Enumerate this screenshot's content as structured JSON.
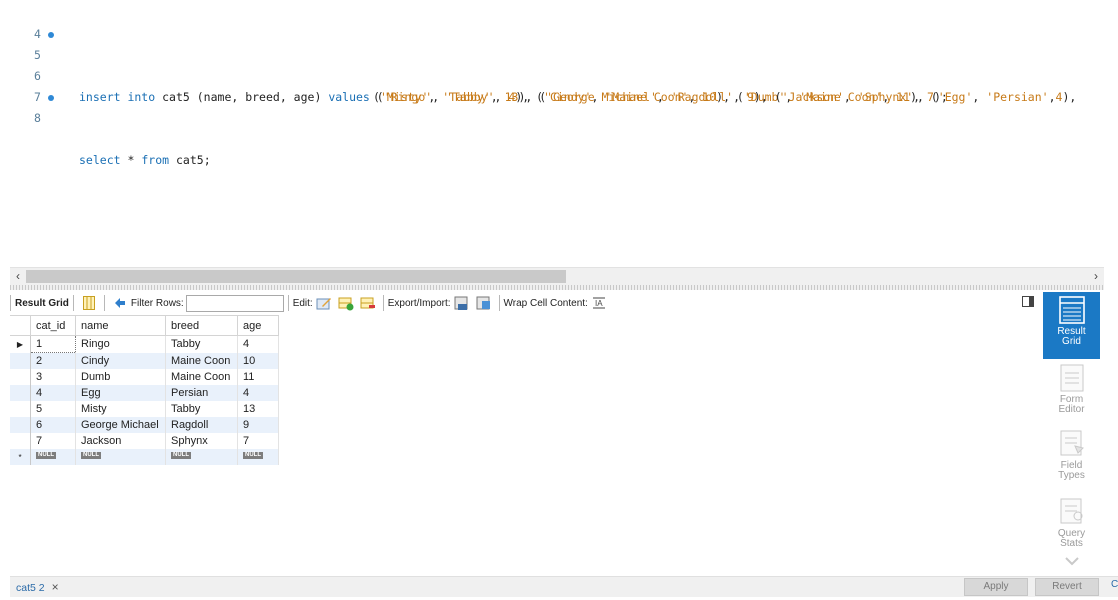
{
  "editor": {
    "lines": [
      {
        "num": "4",
        "dot": false
      },
      {
        "num": "5",
        "dot": true
      },
      {
        "num": "6",
        "dot": false
      },
      {
        "num": "7",
        "dot": false
      },
      {
        "num": "8",
        "dot": true
      }
    ],
    "insert_kw": "insert into",
    "insert_table": "cat5",
    "insert_cols": "(name, breed, age)",
    "values_kw": "values",
    "row1": [
      "'Ringo'",
      "'Tabby'",
      "4"
    ],
    "row2": [
      "'Cindy'",
      "'Maine Coon'",
      "10"
    ],
    "row3": [
      "'Dumb'",
      "'Maine Coon'",
      "11"
    ],
    "row4": [
      "'Egg'",
      "'Persian'",
      "4"
    ],
    "row5": [
      "'Misty'",
      "'Tabby'",
      "13"
    ],
    "row6": [
      "'George Michael'",
      "'Ragdoll'",
      "9"
    ],
    "row7": [
      "'Jackson'",
      "'Sphynx'",
      "7"
    ],
    "select_kw": "select",
    "select_star": "*",
    "from_kw": "from",
    "select_table": "cat5;"
  },
  "toolbar": {
    "result_grid": "Result Grid",
    "filter_rows": "Filter Rows:",
    "filter_value": "",
    "edit": "Edit:",
    "export_import": "Export/Import:",
    "wrap": "Wrap Cell Content:"
  },
  "grid": {
    "columns": [
      "cat_id",
      "name",
      "breed",
      "age"
    ],
    "rows": [
      [
        "1",
        "Ringo",
        "Tabby",
        "4"
      ],
      [
        "2",
        "Cindy",
        "Maine Coon",
        "10"
      ],
      [
        "3",
        "Dumb",
        "Maine Coon",
        "11"
      ],
      [
        "4",
        "Egg",
        "Persian",
        "4"
      ],
      [
        "5",
        "Misty",
        "Tabby",
        "13"
      ],
      [
        "6",
        "George Michael",
        "Ragdoll",
        "9"
      ],
      [
        "7",
        "Jackson",
        "Sphynx",
        "7"
      ]
    ],
    "null_label": "NULL",
    "current_marker": "▶",
    "new_marker": "*"
  },
  "side": {
    "result_grid_1": "Result",
    "result_grid_2": "Grid",
    "form_editor_1": "Form",
    "form_editor_2": "Editor",
    "field_types_1": "Field",
    "field_types_2": "Types",
    "query_stats_1": "Query",
    "query_stats_2": "Stats"
  },
  "bottom": {
    "tab_label": "cat5 2",
    "tab_close": "×",
    "apply": "Apply",
    "revert": "Revert",
    "edge_char": "C"
  },
  "colors": {
    "accent": "#1b79c5",
    "keyword": "#1a6fb4",
    "string": "#c77a18",
    "row_alt": "#e9f1fb"
  }
}
